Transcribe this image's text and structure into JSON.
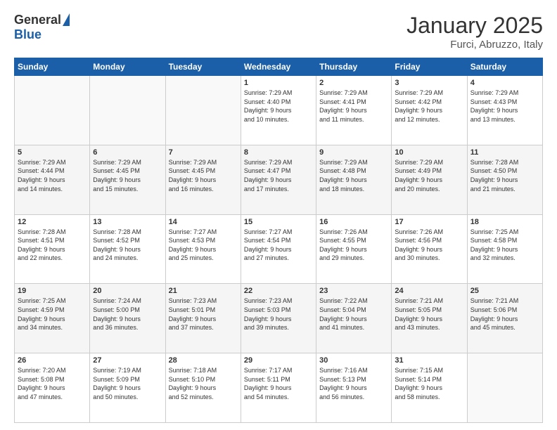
{
  "header": {
    "logo_general": "General",
    "logo_blue": "Blue",
    "title": "January 2025",
    "subtitle": "Furci, Abruzzo, Italy"
  },
  "weekdays": [
    "Sunday",
    "Monday",
    "Tuesday",
    "Wednesday",
    "Thursday",
    "Friday",
    "Saturday"
  ],
  "weeks": [
    [
      {
        "day": "",
        "info": ""
      },
      {
        "day": "",
        "info": ""
      },
      {
        "day": "",
        "info": ""
      },
      {
        "day": "1",
        "info": "Sunrise: 7:29 AM\nSunset: 4:40 PM\nDaylight: 9 hours\nand 10 minutes."
      },
      {
        "day": "2",
        "info": "Sunrise: 7:29 AM\nSunset: 4:41 PM\nDaylight: 9 hours\nand 11 minutes."
      },
      {
        "day": "3",
        "info": "Sunrise: 7:29 AM\nSunset: 4:42 PM\nDaylight: 9 hours\nand 12 minutes."
      },
      {
        "day": "4",
        "info": "Sunrise: 7:29 AM\nSunset: 4:43 PM\nDaylight: 9 hours\nand 13 minutes."
      }
    ],
    [
      {
        "day": "5",
        "info": "Sunrise: 7:29 AM\nSunset: 4:44 PM\nDaylight: 9 hours\nand 14 minutes."
      },
      {
        "day": "6",
        "info": "Sunrise: 7:29 AM\nSunset: 4:45 PM\nDaylight: 9 hours\nand 15 minutes."
      },
      {
        "day": "7",
        "info": "Sunrise: 7:29 AM\nSunset: 4:45 PM\nDaylight: 9 hours\nand 16 minutes."
      },
      {
        "day": "8",
        "info": "Sunrise: 7:29 AM\nSunset: 4:47 PM\nDaylight: 9 hours\nand 17 minutes."
      },
      {
        "day": "9",
        "info": "Sunrise: 7:29 AM\nSunset: 4:48 PM\nDaylight: 9 hours\nand 18 minutes."
      },
      {
        "day": "10",
        "info": "Sunrise: 7:29 AM\nSunset: 4:49 PM\nDaylight: 9 hours\nand 20 minutes."
      },
      {
        "day": "11",
        "info": "Sunrise: 7:28 AM\nSunset: 4:50 PM\nDaylight: 9 hours\nand 21 minutes."
      }
    ],
    [
      {
        "day": "12",
        "info": "Sunrise: 7:28 AM\nSunset: 4:51 PM\nDaylight: 9 hours\nand 22 minutes."
      },
      {
        "day": "13",
        "info": "Sunrise: 7:28 AM\nSunset: 4:52 PM\nDaylight: 9 hours\nand 24 minutes."
      },
      {
        "day": "14",
        "info": "Sunrise: 7:27 AM\nSunset: 4:53 PM\nDaylight: 9 hours\nand 25 minutes."
      },
      {
        "day": "15",
        "info": "Sunrise: 7:27 AM\nSunset: 4:54 PM\nDaylight: 9 hours\nand 27 minutes."
      },
      {
        "day": "16",
        "info": "Sunrise: 7:26 AM\nSunset: 4:55 PM\nDaylight: 9 hours\nand 29 minutes."
      },
      {
        "day": "17",
        "info": "Sunrise: 7:26 AM\nSunset: 4:56 PM\nDaylight: 9 hours\nand 30 minutes."
      },
      {
        "day": "18",
        "info": "Sunrise: 7:25 AM\nSunset: 4:58 PM\nDaylight: 9 hours\nand 32 minutes."
      }
    ],
    [
      {
        "day": "19",
        "info": "Sunrise: 7:25 AM\nSunset: 4:59 PM\nDaylight: 9 hours\nand 34 minutes."
      },
      {
        "day": "20",
        "info": "Sunrise: 7:24 AM\nSunset: 5:00 PM\nDaylight: 9 hours\nand 36 minutes."
      },
      {
        "day": "21",
        "info": "Sunrise: 7:23 AM\nSunset: 5:01 PM\nDaylight: 9 hours\nand 37 minutes."
      },
      {
        "day": "22",
        "info": "Sunrise: 7:23 AM\nSunset: 5:03 PM\nDaylight: 9 hours\nand 39 minutes."
      },
      {
        "day": "23",
        "info": "Sunrise: 7:22 AM\nSunset: 5:04 PM\nDaylight: 9 hours\nand 41 minutes."
      },
      {
        "day": "24",
        "info": "Sunrise: 7:21 AM\nSunset: 5:05 PM\nDaylight: 9 hours\nand 43 minutes."
      },
      {
        "day": "25",
        "info": "Sunrise: 7:21 AM\nSunset: 5:06 PM\nDaylight: 9 hours\nand 45 minutes."
      }
    ],
    [
      {
        "day": "26",
        "info": "Sunrise: 7:20 AM\nSunset: 5:08 PM\nDaylight: 9 hours\nand 47 minutes."
      },
      {
        "day": "27",
        "info": "Sunrise: 7:19 AM\nSunset: 5:09 PM\nDaylight: 9 hours\nand 50 minutes."
      },
      {
        "day": "28",
        "info": "Sunrise: 7:18 AM\nSunset: 5:10 PM\nDaylight: 9 hours\nand 52 minutes."
      },
      {
        "day": "29",
        "info": "Sunrise: 7:17 AM\nSunset: 5:11 PM\nDaylight: 9 hours\nand 54 minutes."
      },
      {
        "day": "30",
        "info": "Sunrise: 7:16 AM\nSunset: 5:13 PM\nDaylight: 9 hours\nand 56 minutes."
      },
      {
        "day": "31",
        "info": "Sunrise: 7:15 AM\nSunset: 5:14 PM\nDaylight: 9 hours\nand 58 minutes."
      },
      {
        "day": "",
        "info": ""
      }
    ]
  ]
}
